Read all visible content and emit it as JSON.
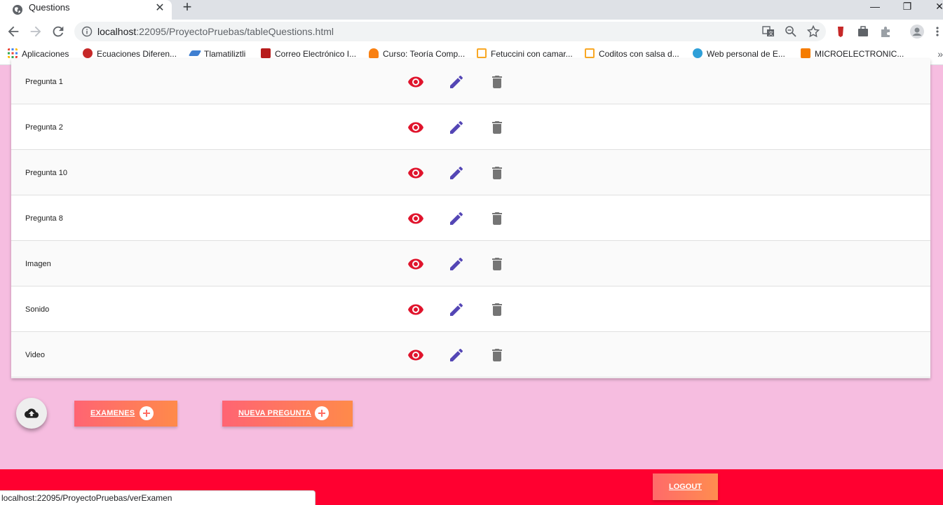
{
  "browser": {
    "tab_title": "Questions",
    "tab_close": "✕",
    "new_tab": "+",
    "url_host": "localhost",
    "url_rest": ":22095/ProyectoPruebas/tableQuestions.html",
    "window_controls": {
      "minimize": "—",
      "restore": "❐",
      "close": "✕"
    },
    "bookmarks": [
      {
        "label": "Aplicaciones",
        "icon": "apps-grid-icon",
        "color": "#4285f4"
      },
      {
        "label": "Ecuaciones Diferen...",
        "icon": "apple-icon",
        "color": "#c62828"
      },
      {
        "label": "Tlamatiliztli",
        "icon": "feather-icon",
        "color": "#3f7fd1"
      },
      {
        "label": "Correo Electrónico I...",
        "icon": "shield-icon",
        "color": "#b71c1c"
      },
      {
        "label": "Curso: Teoría Comp...",
        "icon": "moodle-icon",
        "color": "#f98012"
      },
      {
        "label": "Fetuccini con camar...",
        "icon": "bookmark-icon",
        "color": "#f9a825"
      },
      {
        "label": "Coditos con salsa d...",
        "icon": "bookmark-icon",
        "color": "#f9a825"
      },
      {
        "label": "Web personal de E...",
        "icon": "globe-icon",
        "color": "#2e9fd8"
      },
      {
        "label": "MICROELECTRONIC...",
        "icon": "blogger-icon",
        "color": "#f57c00"
      }
    ],
    "bookmarks_more": "»",
    "status_url": "localhost:22095/ProyectoPruebas/verExamen"
  },
  "colors": {
    "page_bg": "#f6bde0",
    "footer_bg": "#ff0030",
    "eye": "#e0142c",
    "edit": "#5446b5",
    "delete": "#757575"
  },
  "questions": [
    {
      "name": "Pregunta 1"
    },
    {
      "name": "Pregunta 2"
    },
    {
      "name": "Pregunta 10"
    },
    {
      "name": "Pregunta 8"
    },
    {
      "name": "Imagen"
    },
    {
      "name": "Sonido"
    },
    {
      "name": "Video"
    }
  ],
  "actions": {
    "examenes_label": "EXAMENES",
    "nueva_pregunta_label": "NUEVA PREGUNTA",
    "logout_label": "LOGOUT"
  }
}
